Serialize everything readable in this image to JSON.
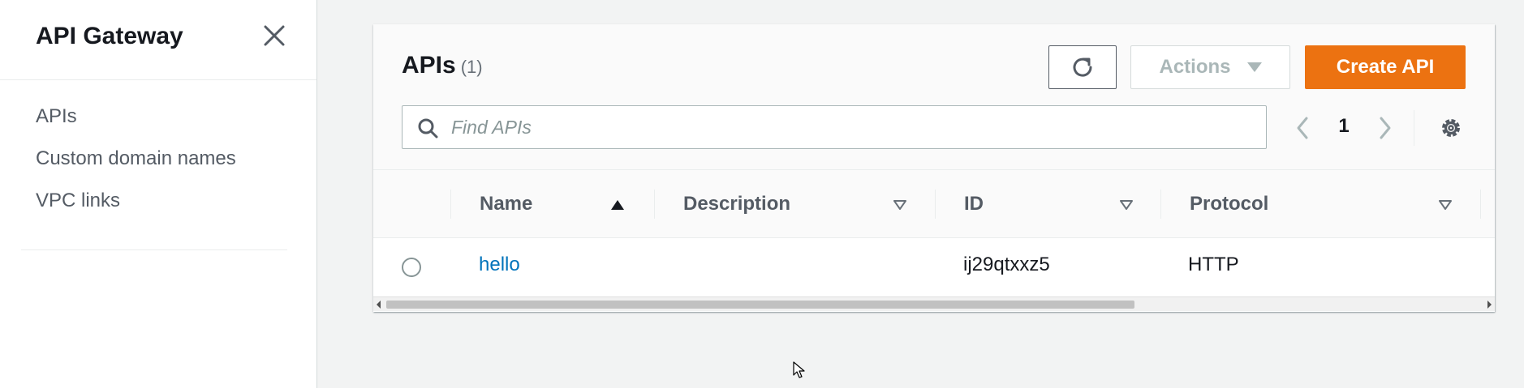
{
  "sidebar": {
    "title": "API Gateway",
    "items": [
      {
        "label": "APIs"
      },
      {
        "label": "Custom domain names"
      },
      {
        "label": "VPC links"
      }
    ]
  },
  "panel": {
    "title": "APIs",
    "count": "(1)",
    "actions_label": "Actions",
    "create_label": "Create API",
    "search_placeholder": "Find APIs",
    "search_value": "",
    "page": "1"
  },
  "table": {
    "columns": [
      "Name",
      "Description",
      "ID",
      "Protocol"
    ],
    "rows": [
      {
        "name": "hello",
        "description": "",
        "id": "ij29qtxxz5",
        "protocol": "HTTP"
      }
    ]
  },
  "colors": {
    "accent": "#ec7211",
    "link": "#0073bb"
  },
  "icons": [
    "close-icon",
    "refresh-icon",
    "caret-down-icon",
    "search-icon",
    "chevron-left-icon",
    "chevron-right-icon",
    "settings-icon",
    "sort-ascending-icon",
    "sort-descending-icon",
    "mouse-cursor-icon"
  ]
}
